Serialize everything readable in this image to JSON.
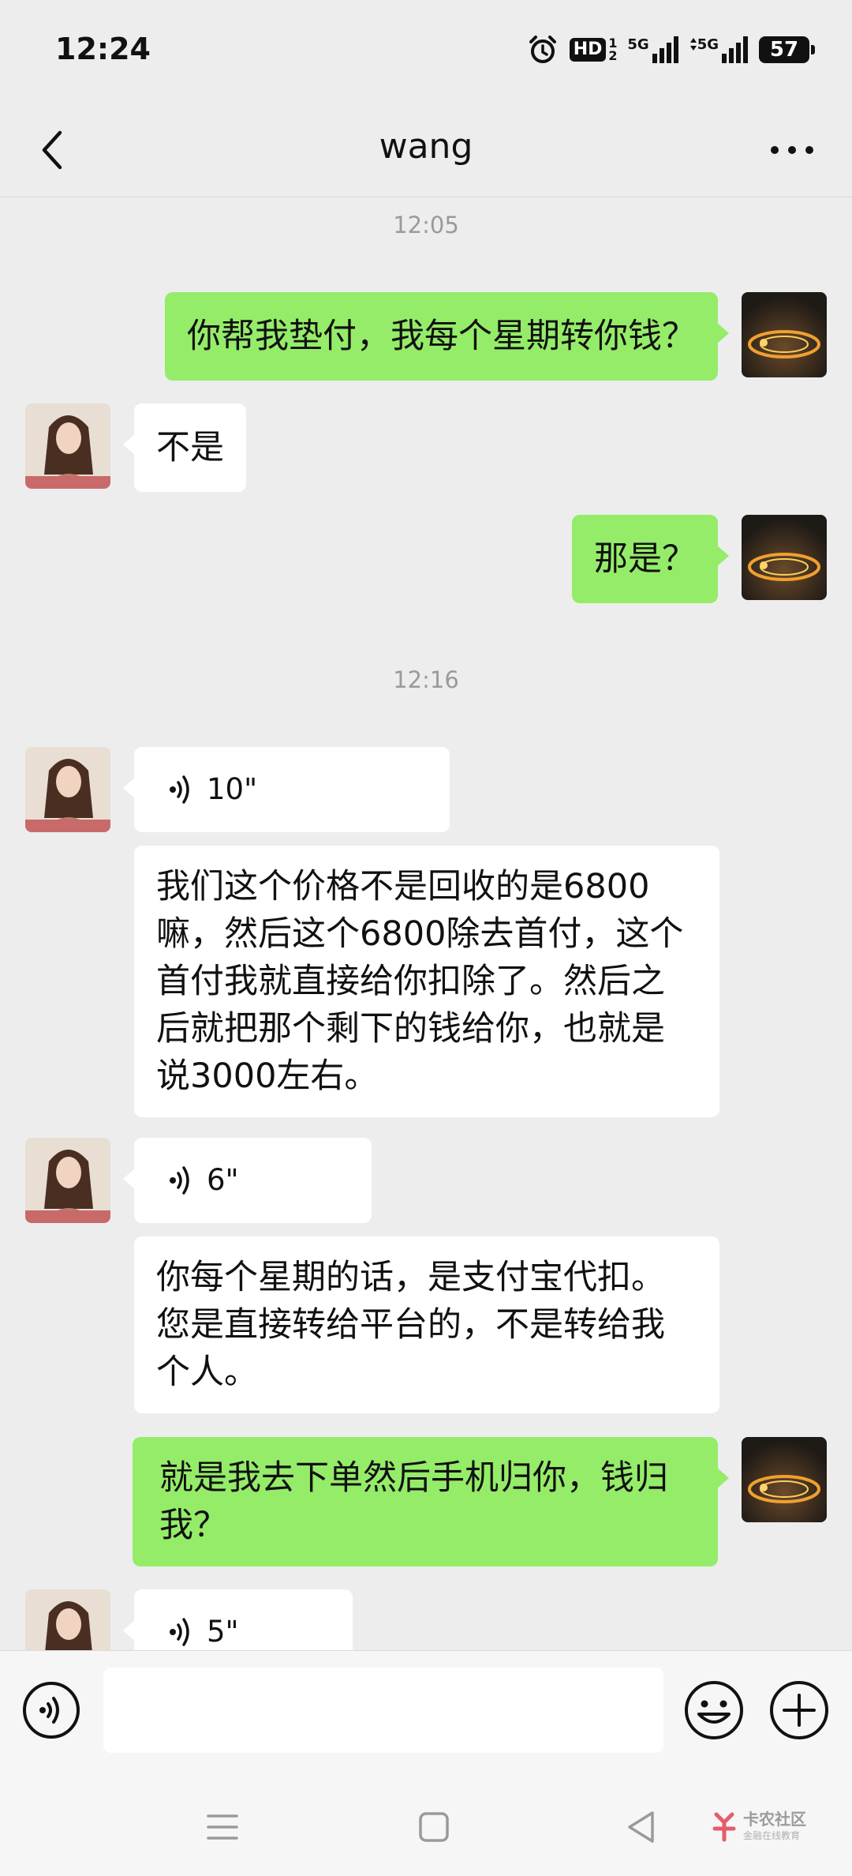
{
  "status_bar": {
    "time": "12:24",
    "hd_label": "HD",
    "hd_sub": "1 2",
    "net1": "5G",
    "net2": "5G",
    "battery": "57"
  },
  "nav": {
    "title": "wang",
    "back_icon": "chevron-left-icon",
    "more_icon": "more-dots-icon"
  },
  "messages": {
    "time1": "12:05",
    "m1": "你帮我垫付，我每个星期转你钱？",
    "m2": "不是",
    "m3": "那是？",
    "time2": "12:16",
    "v1": "10\"",
    "m4": "我们这个价格不是回收的是6800\n嘛，然后这个6800除去首付，这个\n首付我就直接给你扣除了。然后之\n后就把那个剩下的钱给你，也就是\n说3000左右。",
    "v2": "6\"",
    "m5": "你每个星期的话，是支付宝代扣。\n您是直接转给平台的，不是转给我\n个人。",
    "m6": "就是我去下单然后手机归你，钱归\n我？",
    "v3": "5\""
  },
  "input": {
    "placeholder": "",
    "voice_icon": "voice-input-icon",
    "emoji_icon": "emoji-icon",
    "plus_icon": "plus-icon"
  },
  "watermark": {
    "title": "卡农社区",
    "subtitle": "金融在线教育"
  },
  "colors": {
    "out_bubble": "#95ec69",
    "in_bubble": "#ffffff",
    "background": "#ededed"
  }
}
